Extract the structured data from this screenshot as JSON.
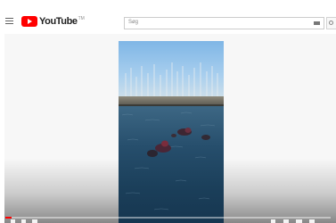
{
  "header": {
    "logo_text": "YouTube",
    "logo_region": "TM",
    "search": {
      "placeholder": "Søg"
    },
    "icons": [
      "menu-icon",
      "youtube-logo-icon",
      "keyboard-icon",
      "search-icon"
    ]
  },
  "player": {
    "progress": 0.02,
    "accent_color": "#ff0000",
    "control_icons": [
      "play-icon",
      "next-icon",
      "volume-icon",
      "settings-icon",
      "miniplayer-icon",
      "theater-icon",
      "fullscreen-icon"
    ]
  }
}
